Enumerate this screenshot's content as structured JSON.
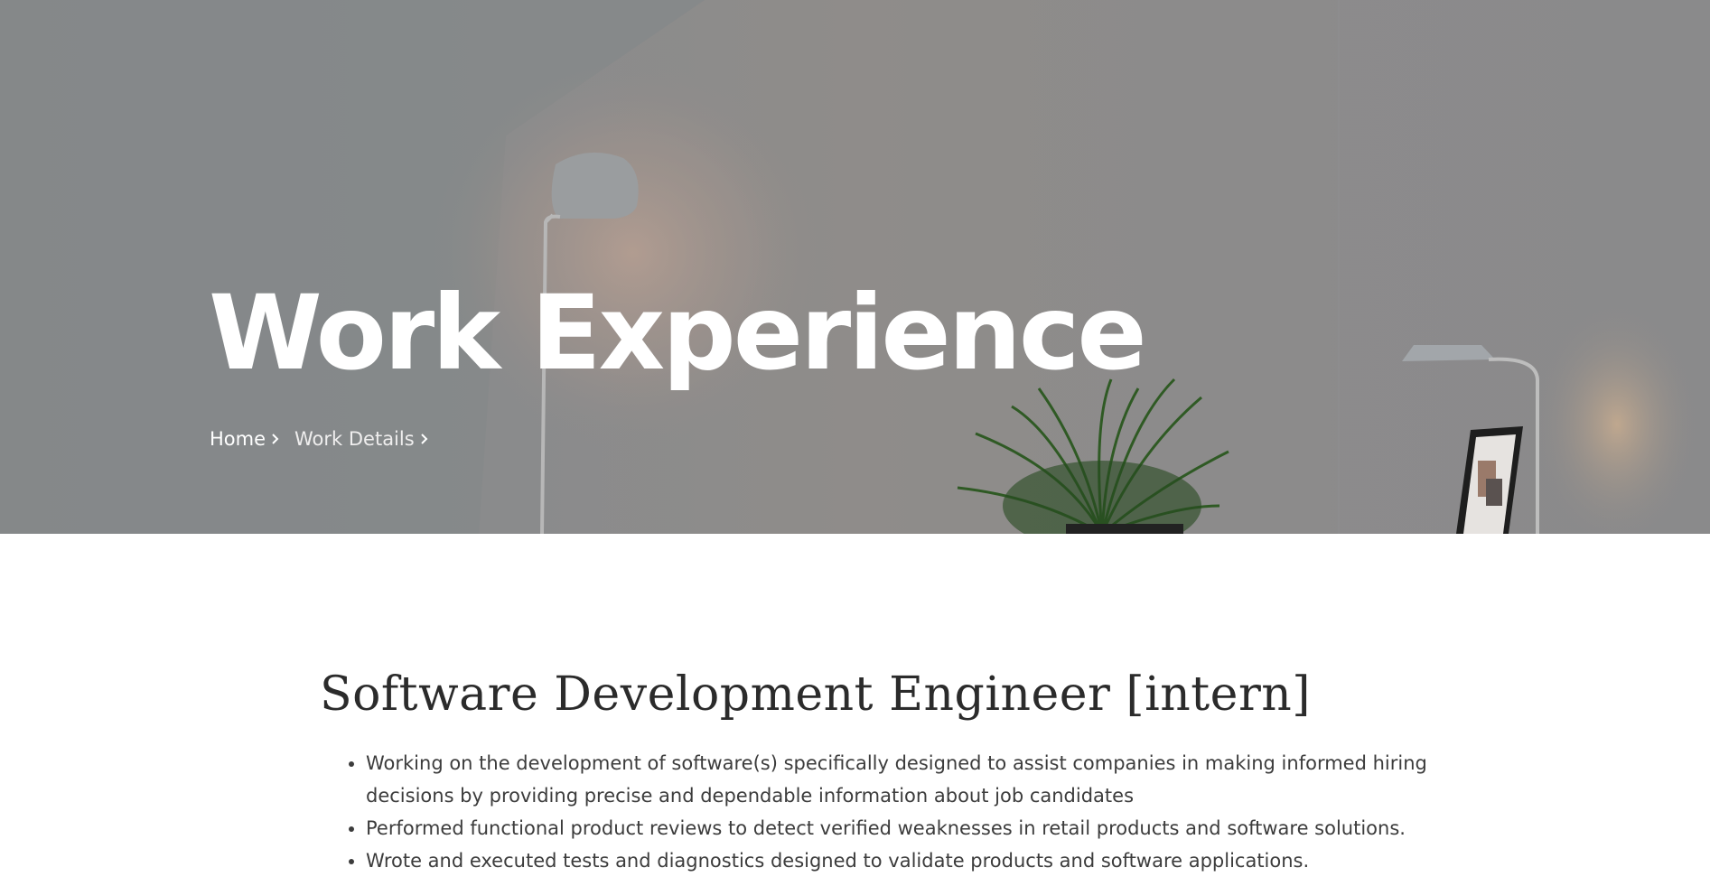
{
  "hero": {
    "title": "Work Experience",
    "breadcrumb": [
      {
        "label": "Home"
      },
      {
        "label": "Work Details"
      }
    ]
  },
  "job": {
    "title": "Software Development Engineer [intern]",
    "duties": [
      "Working on the development of software(s) specifically designed to assist companies in making informed hiring decisions by providing precise and dependable information about job candidates",
      "Performed functional product reviews to detect verified weaknesses in retail products and software solutions.",
      "Wrote and executed tests and diagnostics designed to validate products and software applications."
    ]
  },
  "icons": {
    "breadcrumb_separator": "chevron-right-icon"
  },
  "colors": {
    "hero_overlay": "#898a8b",
    "title_text": "#ffffff",
    "heading_text": "#2b2b2b",
    "body_text": "#3c3c3c"
  }
}
